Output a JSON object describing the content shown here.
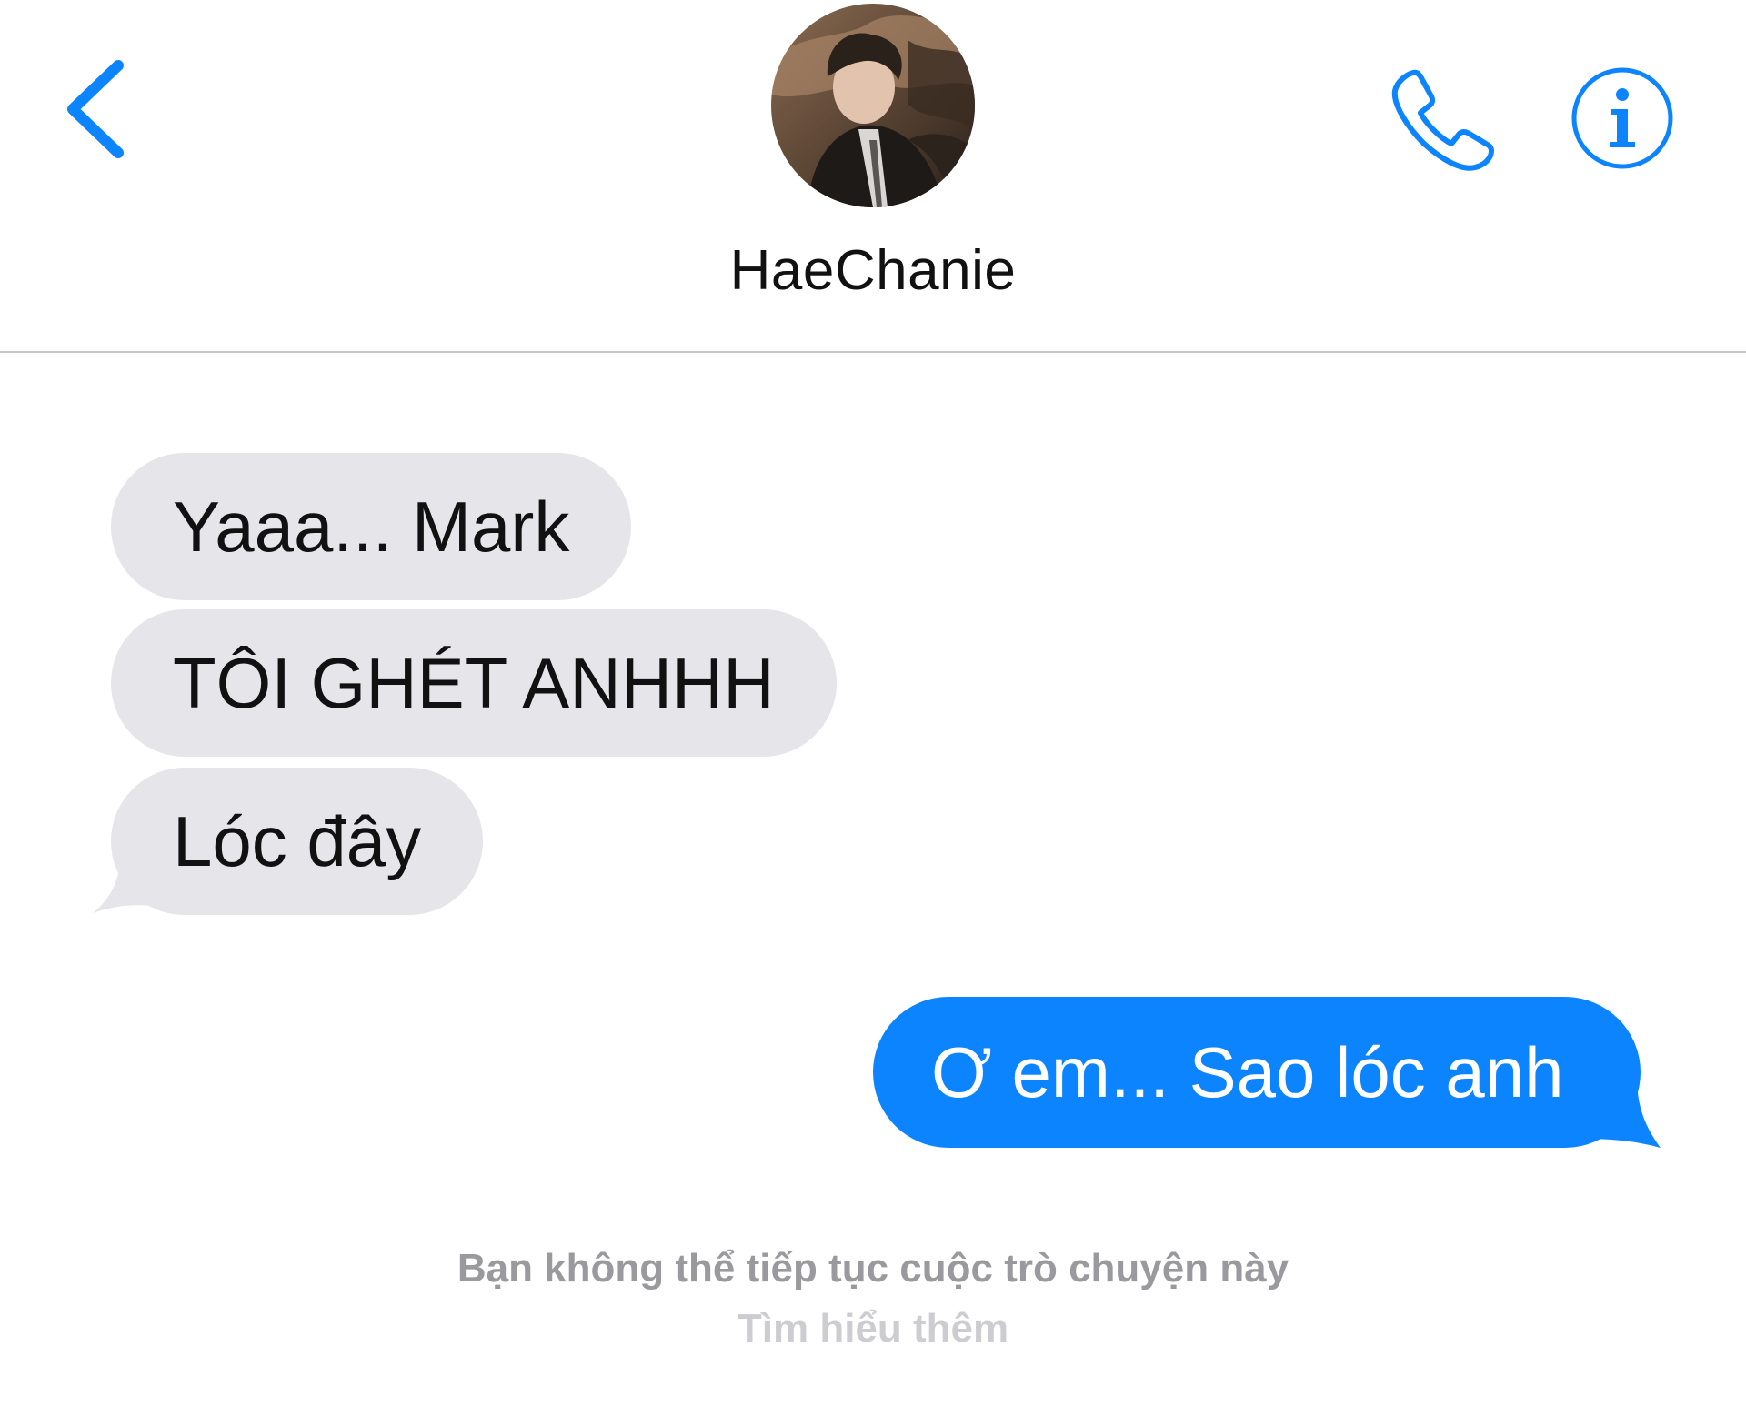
{
  "header": {
    "back_icon": "chevron-left-icon",
    "contact_name": "HaeChanie",
    "avatar": "contact-avatar-photo",
    "call_icon": "phone-icon",
    "info_icon": "info-icon",
    "accent_color": "#0b84fe"
  },
  "messages": [
    {
      "direction": "incoming",
      "text": "Yaaa... Mark"
    },
    {
      "direction": "incoming",
      "text": "TÔI GHÉT ANHHH"
    },
    {
      "direction": "incoming",
      "text": "Lóc đây"
    },
    {
      "direction": "outgoing",
      "text": "Ơ em... Sao lóc anh"
    }
  ],
  "colors": {
    "incoming_bubble": "#e5e5ea",
    "outgoing_bubble": "#0b84fe",
    "notice_text": "#9a9a9e",
    "link_text": "#cdcdd1"
  },
  "footer": {
    "notice": "Bạn không thể tiếp tục cuộc trò chuyện này",
    "link": "Tìm hiểu thêm"
  }
}
